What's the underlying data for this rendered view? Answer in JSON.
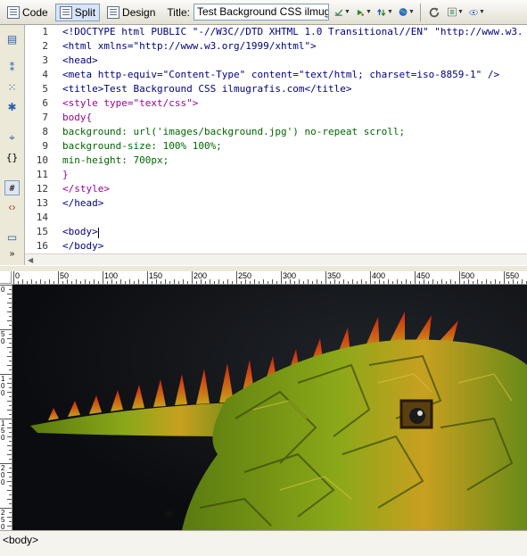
{
  "toolbar": {
    "code_label": "Code",
    "split_label": "Split",
    "design_label": "Design",
    "title_label": "Title:",
    "title_value": "Test Background CSS ilmugrafis"
  },
  "code_lines": [
    {
      "n": "1",
      "text": "<!DOCTYPE html PUBLIC \"-//W3C//DTD XHTML 1.0 Transitional//EN\" \"http://www.w3.",
      "kind": "tag"
    },
    {
      "n": "2",
      "text": "<html xmlns=\"http://www.w3.org/1999/xhtml\">",
      "kind": "tag"
    },
    {
      "n": "3",
      "text": "<head>",
      "kind": "tag"
    },
    {
      "n": "4",
      "text": "<meta http-equiv=\"Content-Type\" content=\"text/html; charset=iso-8859-1\" />",
      "kind": "tag"
    },
    {
      "n": "5",
      "text": "<title>Test Background CSS ilmugrafis.com</title>",
      "kind": "tag"
    },
    {
      "n": "6",
      "text": "<style type=\"text/css\">",
      "kind": "style"
    },
    {
      "n": "7",
      "text": "body{",
      "kind": "style"
    },
    {
      "n": "8",
      "text": "background: url('images/background.jpg') no-repeat scroll;",
      "kind": "prop"
    },
    {
      "n": "9",
      "text": "background-size: 100% 100%;",
      "kind": "prop"
    },
    {
      "n": "10",
      "text": "min-height: 700px;",
      "kind": "prop"
    },
    {
      "n": "11",
      "text": "}",
      "kind": "style"
    },
    {
      "n": "12",
      "text": "</style>",
      "kind": "style"
    },
    {
      "n": "13",
      "text": "</head>",
      "kind": "tag"
    },
    {
      "n": "14",
      "text": "",
      "kind": "tag"
    },
    {
      "n": "15",
      "text": "<body>",
      "kind": "tag"
    },
    {
      "n": "16",
      "text": "</body>",
      "kind": "tag"
    }
  ],
  "ruler": {
    "top_labels": [
      "0",
      "50",
      "100",
      "150",
      "200",
      "250",
      "300",
      "350",
      "400",
      "450",
      "500",
      "550"
    ],
    "left_labels": [
      "0",
      "50",
      "100",
      "150",
      "200",
      "250"
    ]
  },
  "status": {
    "tag_selector": "<body>"
  },
  "colors": {
    "code_tag": "#000080",
    "code_style": "#990099",
    "code_prop": "#006600"
  },
  "icons": {
    "toolbar": [
      "code-view-icon",
      "split-view-icon",
      "design-view-icon",
      "file-management-icon",
      "preview-in-browser-icon",
      "refresh-icon",
      "view-options-icon",
      "visual-aids-icon"
    ],
    "gutter": [
      "open-documents-icon",
      "collapse-full-tag-icon",
      "collapse-selection-icon",
      "expand-all-icon",
      "select-parent-tag-icon",
      "balance-braces-icon",
      "line-numbers-icon",
      "highlight-invalid-code-icon",
      "apply-comment-icon",
      "more-icon"
    ]
  }
}
